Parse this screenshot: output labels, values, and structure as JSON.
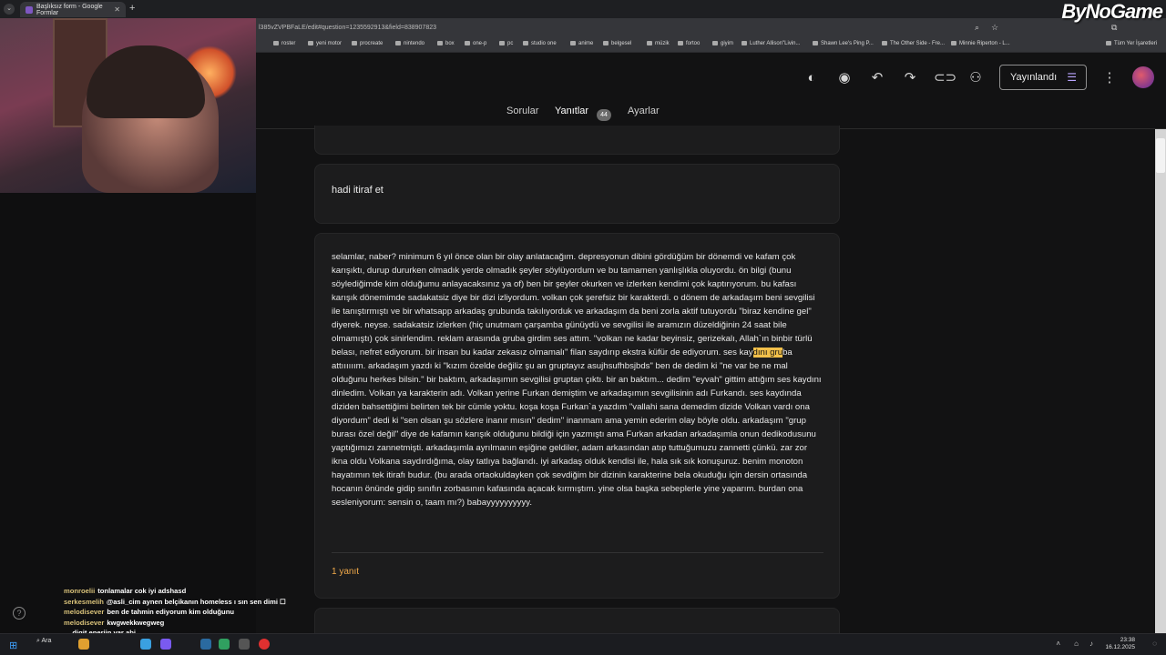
{
  "browser": {
    "tab_title": "Başlıksız form - Google Formlar",
    "url": "l385vZVPBFaLE/edit#question=1235592913&field=838907823",
    "logo": "ByNoGame",
    "bookmarks": [
      "roster",
      "yeni motor",
      "procreate",
      "nintendo",
      "box",
      "one-p",
      "pc",
      "studio one",
      "anime",
      "belgesel",
      "müzik",
      "fortoo",
      "giyim",
      "Luther Allison\"Livin...",
      "Shawn Lee's Ping P...",
      "The Other Side - Fre...",
      "Minnie Riperton - L...",
      "Tüm Yer İşaretleri"
    ]
  },
  "toolbar": {
    "publish_label": "Yayınlandı",
    "icons": [
      "palette-icon",
      "preview-icon",
      "undo-icon",
      "redo-icon",
      "link-icon",
      "add-collaborator-icon",
      "more-icon"
    ]
  },
  "tabs": {
    "questions": "Sorular",
    "responses": "Yanıtlar",
    "responses_count": "44",
    "settings": "Ayarlar"
  },
  "question": {
    "title": "hadi itiraf et"
  },
  "response": {
    "text_before": "selamlar, naber? minimum 6 yıl önce olan bir olay anlatacağım. depresyonun dibini gördüğüm bir dönemdi ve kafam çok karışıktı, durup dururken olmadık yerde olmadık şeyler söylüyordum ve bu tamamen yanlışlıkla oluyordu. ön bilgi (bunu söylediğimde kim olduğumu anlayacaksınız ya of) ben bir şeyler okurken ve izlerken kendimi çok kaptırıyorum. bu kafası karışık dönemimde sadakatsiz diye bir dizi izliyordum. volkan çok şerefsiz bir karakterdi. o dönem de arkadaşım beni sevgilisi ile tanıştırmıştı ve bir whatsapp arkadaş grubunda takılıyorduk ve arkadaşım da beni zorla aktif tutuyordu \"biraz kendine gel\" diyerek. neyse. sadakatsiz izlerken (hiç unutmam çarşamba günüydü ve sevgilisi ile aramızın düzeldiğinin 24 saat bile olmamıştı) çok sinirlendim. reklam arasında gruba girdim ses attım. \"volkan ne kadar beyinsiz, gerizekalı, Allah`ın binbir türlü belası, nefret ediyorum. bir insan bu kadar zekasız olmamalı\" filan saydırıp ekstra küfür de ediyorum. ses kay",
    "text_highlight": "dını gru",
    "text_after": "ba attıııııım. arkadaşım yazdı ki \"kızım özelde değiliz şu an gruptayız asujhsufhbsjbds\" ben de dedim ki \"ne var be ne mal olduğunu herkes bilsin.\" bir baktım, arkadaşımın sevgilisi gruptan çıktı. bir an baktım... dedim \"eyvah\" gittim attığım ses kaydını dinledim. Volkan ya karakterin adı. Volkan yerine Furkan demiştim ve arkadaşımın sevgilisinin adı Furkandı. ses kaydında diziden bahsettiğimi belirten tek bir cümle yoktu. koşa koşa Furkan`a yazdım \"vallahi sana demedim dizide Volkan vardı ona diyordum\" dedi ki \"sen olsan şu sözlere inanır mısın\" dedim\" inanmam ama yemin ederim olay böyle oldu. arkadaşım \"grup burası özel değil\" diye de kafamın karışık olduğunu bildiği için yazmıştı ama Furkan arkadan arkadaşımla onun dedikodusunu yaptığımızı zannetmişti. arkadaşımla ayrılmanın eşiğine geldiler, adam arkasından atıp tuttuğumuzu zannetti çünkü. zar zor ikna oldu Volkana saydırdığıma, olay tatlıya bağlandı. iyi arkadaş olduk kendisi ile, hala sık sık konuşuruz. benim monoton hayatımın tek itirafı budur. (bu arada ortaokuldayken çok sevdiğim bir dizinin karakterine bela okuduğu için dersin ortasında hocanın önünde gidip sınıfın zorbasının kafasında açacak kırmıştım. yine olsa başka sebeplerle yine yaparım. burdan ona sesleniyorum: sensin o, taam mı?) babayyyyyyyyyy.",
    "reply_count": "1 yanıt"
  },
  "chat": [
    {
      "name": "monroelii",
      "text": "tonlamalar cok iyi adshasd"
    },
    {
      "name": "serkesmelih",
      "text": "@asli_cim aynen belçikanın homeless ı sın sen dimi ☐"
    },
    {
      "name": "melodisever",
      "text": "ben de tahmin ediyorum kim olduğunu"
    },
    {
      "name": "melodisever",
      "text": "kwgwekkwegweg"
    },
    {
      "name": "...",
      "text": "digit enerjin var abi"
    }
  ],
  "taskbar": {
    "search_label": "Ara",
    "time": "23:38",
    "date": "16.12.2025"
  },
  "colors": {
    "accent": "#b28cff",
    "highlight": "#f2c04a",
    "reply": "#f0a94a"
  }
}
